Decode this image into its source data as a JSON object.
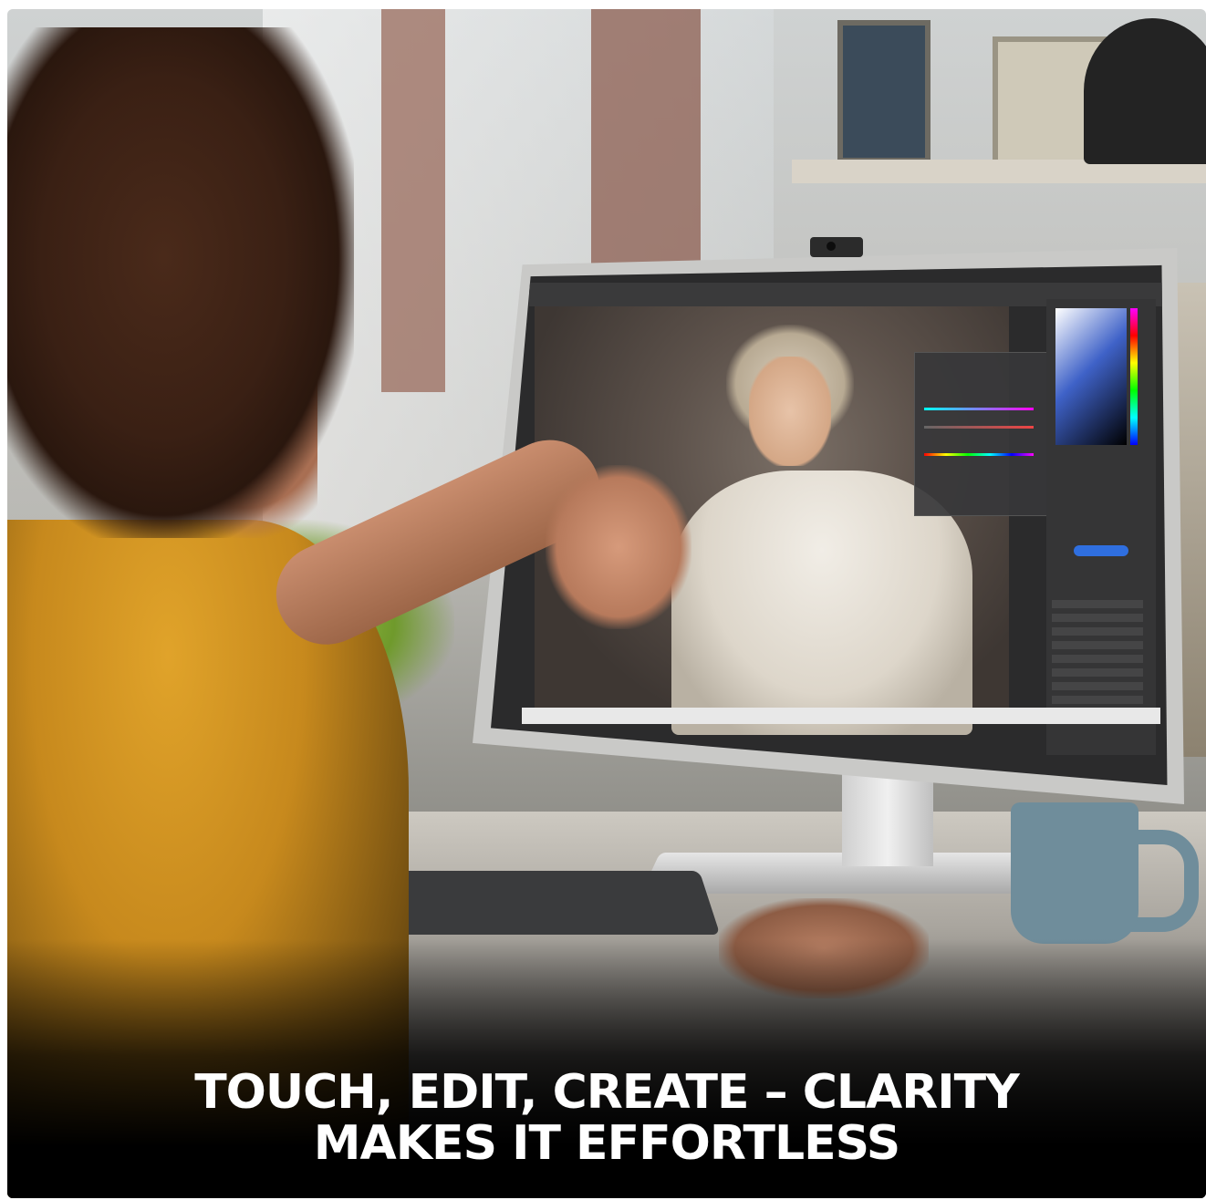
{
  "caption": {
    "line1": "TOUCH, EDIT, CREATE – CLARITY",
    "line2": "MAKES IT EFFORTLESS"
  },
  "colors": {
    "caption_text": "#ffffff",
    "sweater": "#d89a22",
    "explore_button": "#2f6fe0",
    "background_fade": "#000000"
  },
  "icons": [
    "webcam-icon"
  ]
}
